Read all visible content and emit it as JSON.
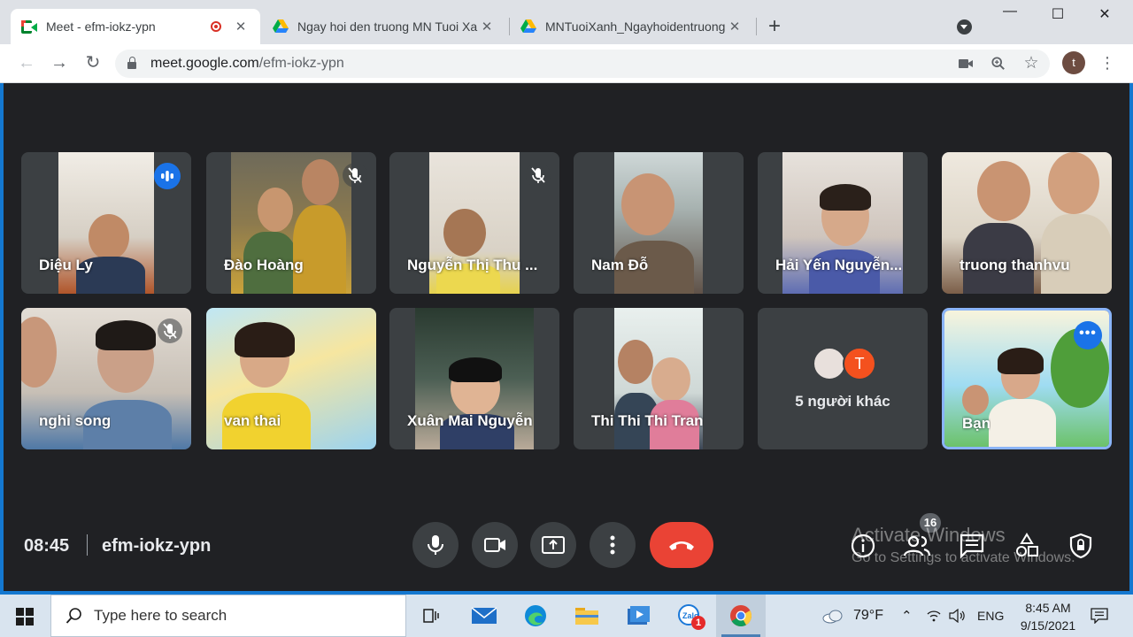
{
  "browser": {
    "tabs": [
      {
        "title": "Meet - efm-iokz-ypn",
        "active": true,
        "icon": "google-meet-icon",
        "recording": true
      },
      {
        "title": "Ngay hoi den truong MN Tuoi Xa",
        "active": false,
        "icon": "google-drive-icon"
      },
      {
        "title": "MNTuoiXanh_Ngayhoidentruong",
        "active": false,
        "icon": "google-drive-icon"
      }
    ],
    "url_host": "meet.google.com",
    "url_path": "/efm-iokz-ypn",
    "profile_initial": "t"
  },
  "meet": {
    "participants": [
      {
        "name": "Diệu Ly",
        "status": "speaking"
      },
      {
        "name": "Đào Hoàng",
        "status": "muted"
      },
      {
        "name": "Nguyễn Thị Thu ...",
        "status": "muted"
      },
      {
        "name": "Nam Đỗ",
        "status": "none"
      },
      {
        "name": "Hải Yến Nguyễn...",
        "status": "none"
      },
      {
        "name": "truong thanhvu",
        "status": "none"
      },
      {
        "name": "nghi song",
        "status": "muted"
      },
      {
        "name": "van thai",
        "status": "none"
      },
      {
        "name": "Xuân Mai Nguyễn",
        "status": "none"
      },
      {
        "name": "Thi Thi Thi Tran",
        "status": "none"
      },
      {
        "name": "Bạn",
        "status": "self"
      }
    ],
    "others": {
      "avatar_letter": "T",
      "label": "5 người khác"
    },
    "clock": "08:45",
    "meeting_code": "efm-iokz-ypn",
    "people_count": "16",
    "watermark_title": "Activate Windows",
    "watermark_sub": "Go to Settings to activate Windows."
  },
  "taskbar": {
    "search_placeholder": "Type here to search",
    "zalo_badge": "1",
    "weather": "79°F",
    "language": "ENG",
    "time": "8:45 AM",
    "date": "9/15/2021"
  },
  "colors": {
    "meet_bg": "#202124",
    "tile_bg": "#3c4043",
    "hangup": "#ea4335",
    "accent": "#1a73e8",
    "self_border": "#8ab4f8"
  }
}
